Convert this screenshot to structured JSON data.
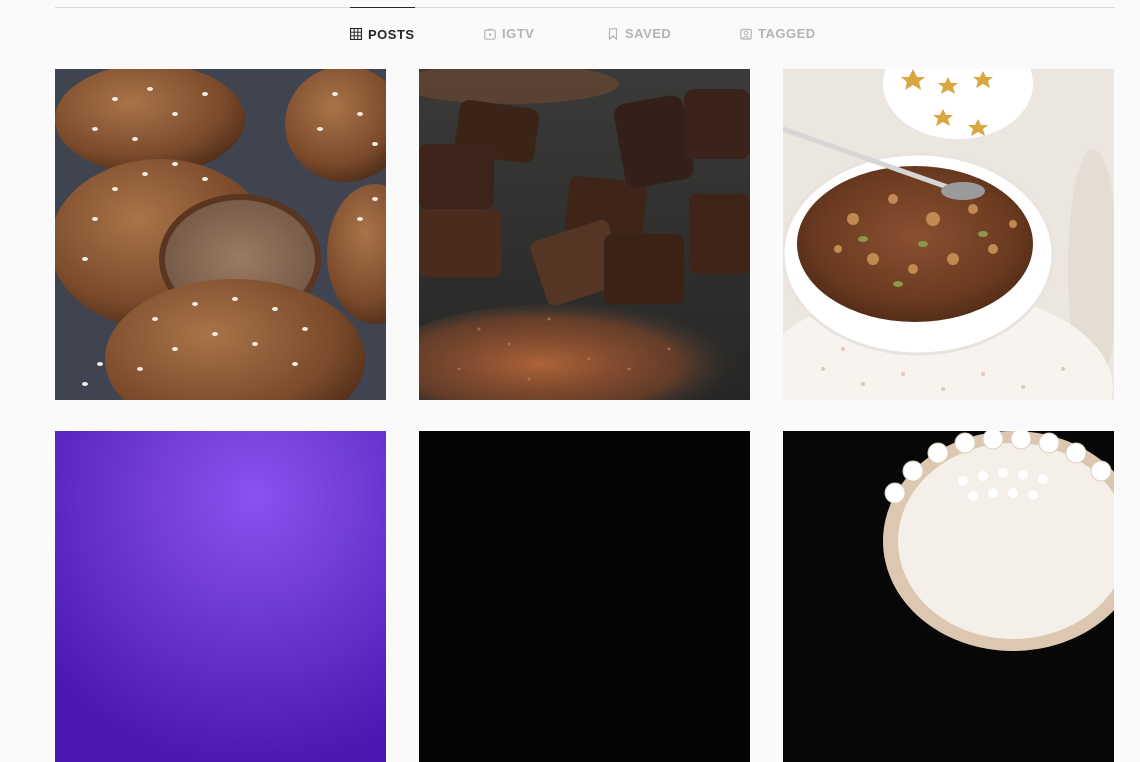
{
  "tabs": [
    {
      "label": "POSTS",
      "icon": "grid-icon",
      "active": true
    },
    {
      "label": "IGTV",
      "icon": "igtv-icon",
      "active": false
    },
    {
      "label": "SAVED",
      "icon": "bookmark-icon",
      "active": false
    },
    {
      "label": "TAGGED",
      "icon": "tag-icon",
      "active": false
    }
  ],
  "colors": {
    "background": "#fafafa",
    "active_tab_text": "#262626",
    "inactive_tab_text": "#b4b4b4",
    "divider": "#dbdbdb"
  },
  "posts": [
    {
      "subject": "sesame-topped brown bread rolls"
    },
    {
      "subject": "chocolate fudge squares with cocoa powder"
    },
    {
      "subject": "bowl of granola with spoon"
    },
    {
      "subject": "purple gradient image"
    },
    {
      "subject": "dark image"
    },
    {
      "subject": "white decorated cake on black background"
    }
  ]
}
